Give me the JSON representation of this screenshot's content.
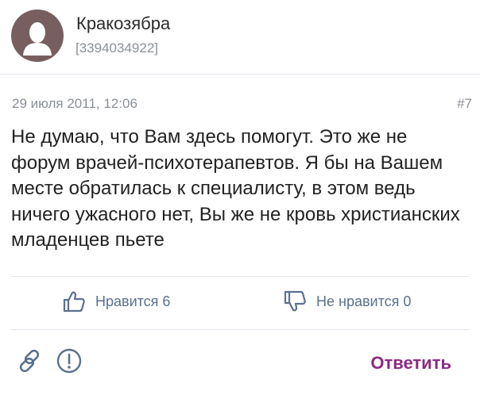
{
  "user": {
    "name": "Кракозябра",
    "id": "[3394034922]",
    "avatar_icon": "person-silhouette-icon",
    "avatar_color": "#775f60"
  },
  "post": {
    "date": "29 июля 2011, 12:06",
    "number": "#7",
    "text": "Не думаю, что Вам здесь помогут. Это же не форум врачей-психотерапевтов. Я бы на Вашем месте обратилась к специалисту, в этом ведь ничего ужасного нет, Вы же не кровь христианских младенцев пьете"
  },
  "actions": {
    "like_label": "Нравится 6",
    "dislike_label": "Не нравится 0",
    "like_icon": "thumbs-up-icon",
    "dislike_icon": "thumbs-down-icon",
    "link_icon": "link-icon",
    "report_icon": "exclamation-circle-icon",
    "reply_label": "Ответить"
  },
  "colors": {
    "accent": "#8b2a82",
    "vote_blue": "#5b708e",
    "muted_text": "#8a9098"
  }
}
